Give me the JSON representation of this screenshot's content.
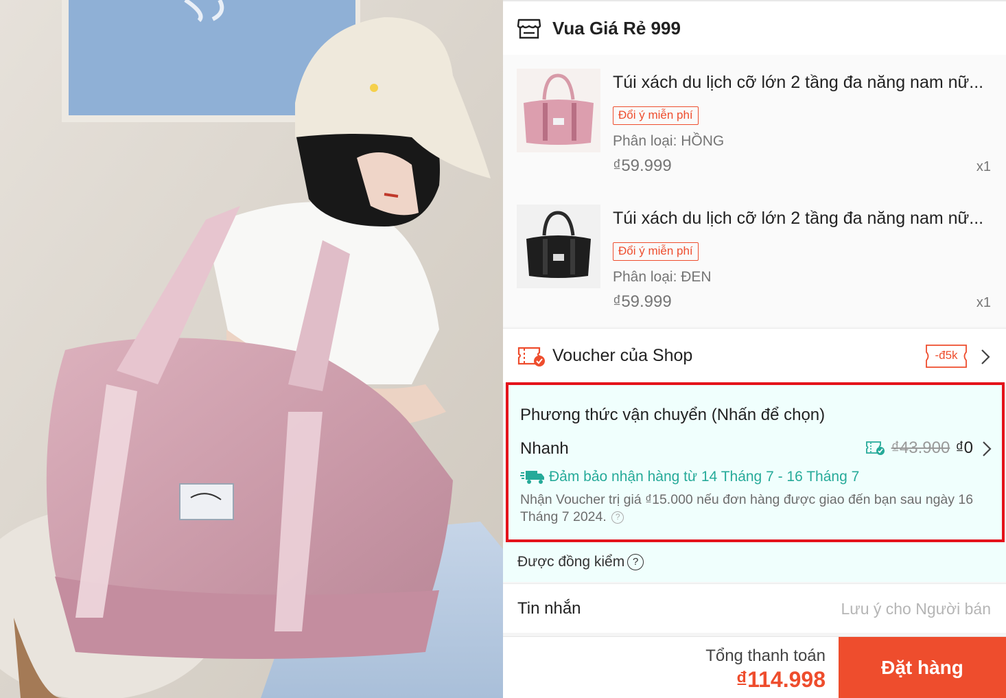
{
  "photo": {
    "icon": "product-photo-woman-with-pink-bag"
  },
  "shop": {
    "name": "Vua Giá Rẻ 999",
    "icon": "store-icon"
  },
  "products": [
    {
      "title": "Túi xách du lịch cỡ lớn 2 tầng đa năng nam nữ...",
      "tag": "Đổi ý miễn phí",
      "variant": "Phân loại: HỒNG",
      "price": "₫59.999",
      "qty": "x1",
      "color": "#d9a3ad"
    },
    {
      "title": "Túi xách du lịch cỡ lớn 2 tầng đa năng nam nữ...",
      "tag": "Đổi ý miễn phí",
      "variant": "Phân loại: ĐEN",
      "price": "₫59.999",
      "qty": "x1",
      "color": "#1f1f1f"
    }
  ],
  "voucher": {
    "label": "Voucher của Shop",
    "badge": "-đ5k"
  },
  "shipping": {
    "title": "Phương thức vận chuyển (Nhấn để chọn)",
    "method": "Nhanh",
    "old_price": "₫43.900",
    "new_price": "₫0",
    "guarantee": "Đảm bảo nhận hàng từ 14 Tháng 7 - 16 Tháng 7",
    "note": "Nhận Voucher trị giá ₫15.000 nếu đơn hàng được giao đến bạn sau ngày 16 Tháng 7 2024."
  },
  "cod": {
    "label": "Được đồng kiểm"
  },
  "message": {
    "label": "Tin nhắn",
    "placeholder": "Lưu ý cho Người bán"
  },
  "footer": {
    "total_label": "Tổng thanh toán",
    "total_value": "₫114.998",
    "order_button": "Đặt hàng"
  },
  "colors": {
    "accent": "#ee4d2d",
    "teal": "#26aa99",
    "highlight_border": "#e4131b"
  }
}
